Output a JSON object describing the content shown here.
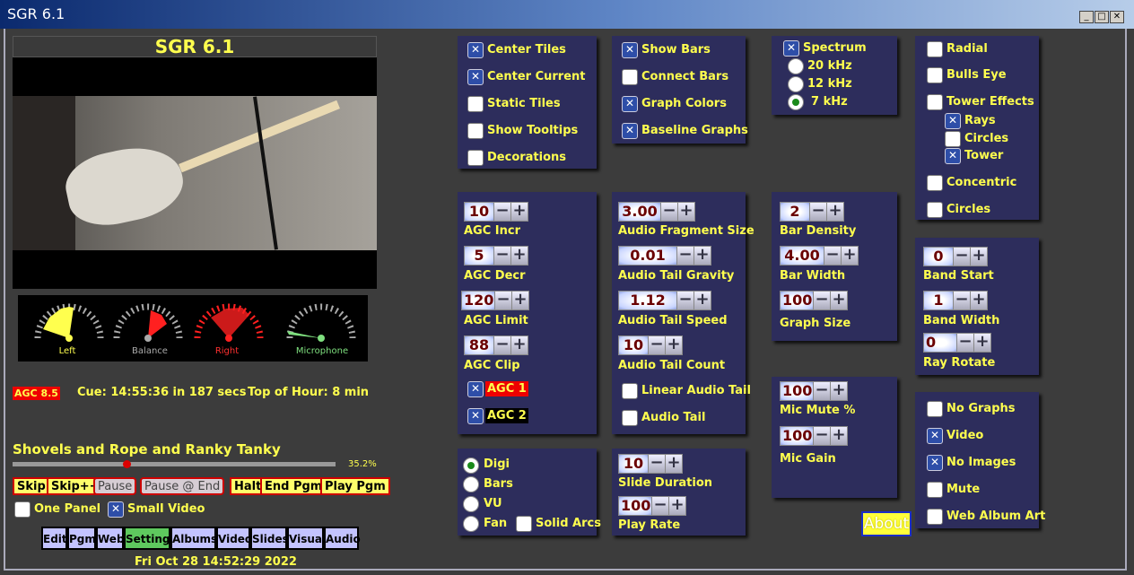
{
  "window": {
    "title": "SGR 6.1"
  },
  "video_header": "SGR 6.1",
  "meters": [
    "Left",
    "Balance",
    "Right",
    "Microphone"
  ],
  "status": {
    "agc": "AGC 8.5",
    "cue": "Cue: 14:55:36  in 187 secs",
    "top_of_hour": "Top of Hour: 8 min"
  },
  "song": {
    "title": "Shovels and Rope and Ranky Tanky",
    "progress_label": "35.2%",
    "progress": 0.352
  },
  "controls": {
    "skip": "Skip",
    "skippp": "Skip++",
    "pause": "Pause",
    "pause_end": "Pause @ End",
    "halt": "Halt",
    "end_pgm": "End Pgm",
    "play_pgm": "Play Pgm"
  },
  "options": {
    "one_panel": "One Panel",
    "small_video": "Small Video"
  },
  "nav": [
    "Edit",
    "Pgm",
    "Web",
    "Settings",
    "Albums",
    "Video",
    "Slides",
    "Visual",
    "Audio"
  ],
  "datetime": "Fri Oct 28 14:52:29 2022",
  "tiles": {
    "center_tiles": "Center Tiles",
    "center_current": "Center Current",
    "static_tiles": "Static Tiles",
    "show_tooltips": "Show Tooltips",
    "decorations": "Decorations"
  },
  "bars": {
    "show_bars": "Show Bars",
    "connect_bars": "Connect Bars",
    "graph_colors": "Graph Colors",
    "baseline_graphs": "Baseline Graphs"
  },
  "spectrum": {
    "label": "Spectrum",
    "r20": "20 kHz",
    "r12": "12 kHz",
    "r7": "7 kHz"
  },
  "effects": {
    "radial": "Radial",
    "bulls_eye": "Bulls Eye",
    "tower_effects": "Tower Effects",
    "rays": "Rays",
    "circles_sub": "Circles",
    "tower": "Tower",
    "concentric": "Concentric",
    "circles": "Circles"
  },
  "agc": {
    "incr_val": "10",
    "incr": "AGC Incr",
    "decr_val": "5",
    "decr": "AGC Decr",
    "limit_val": "120",
    "limit": "AGC Limit",
    "clip_val": "88",
    "clip": "AGC Clip",
    "agc1": "AGC 1",
    "agc2": "AGC 2"
  },
  "audio": {
    "frag_val": "3.00",
    "frag": "Audio Fragment Size",
    "grav_val": "0.01",
    "grav": "Audio Tail  Gravity",
    "speed_val": "1.12",
    "speed": "Audio Tail Speed",
    "count_val": "10",
    "count": "Audio Tail Count",
    "linear": "Linear Audio Tail",
    "tail": "Audio Tail"
  },
  "bar_settings": {
    "density_val": "2",
    "density": "Bar Density",
    "width_val": "4.00",
    "width": "Bar Width",
    "graph_val": "100",
    "graph": "Graph Size"
  },
  "band": {
    "start_val": "0",
    "start": "Band Start",
    "width_val": "1",
    "width": "Band Width",
    "ray_val": "0",
    "ray": "Ray Rotate"
  },
  "mic": {
    "mute_val": "100",
    "mute": "Mic Mute %",
    "gain_val": "100",
    "gain": "Mic Gain"
  },
  "display": {
    "no_graphs": "No Graphs",
    "video": "Video",
    "no_images": "No Images",
    "mute": "Mute",
    "web_album_art": "Web Album Art"
  },
  "meter_type": {
    "digi": "Digi",
    "bars": "Bars",
    "vu": "VU",
    "fan": "Fan",
    "solid_arcs": "Solid Arcs"
  },
  "slides": {
    "dur_val": "10",
    "dur": "Slide Duration",
    "rate_val": "100",
    "rate": "Play Rate"
  },
  "about": "About"
}
